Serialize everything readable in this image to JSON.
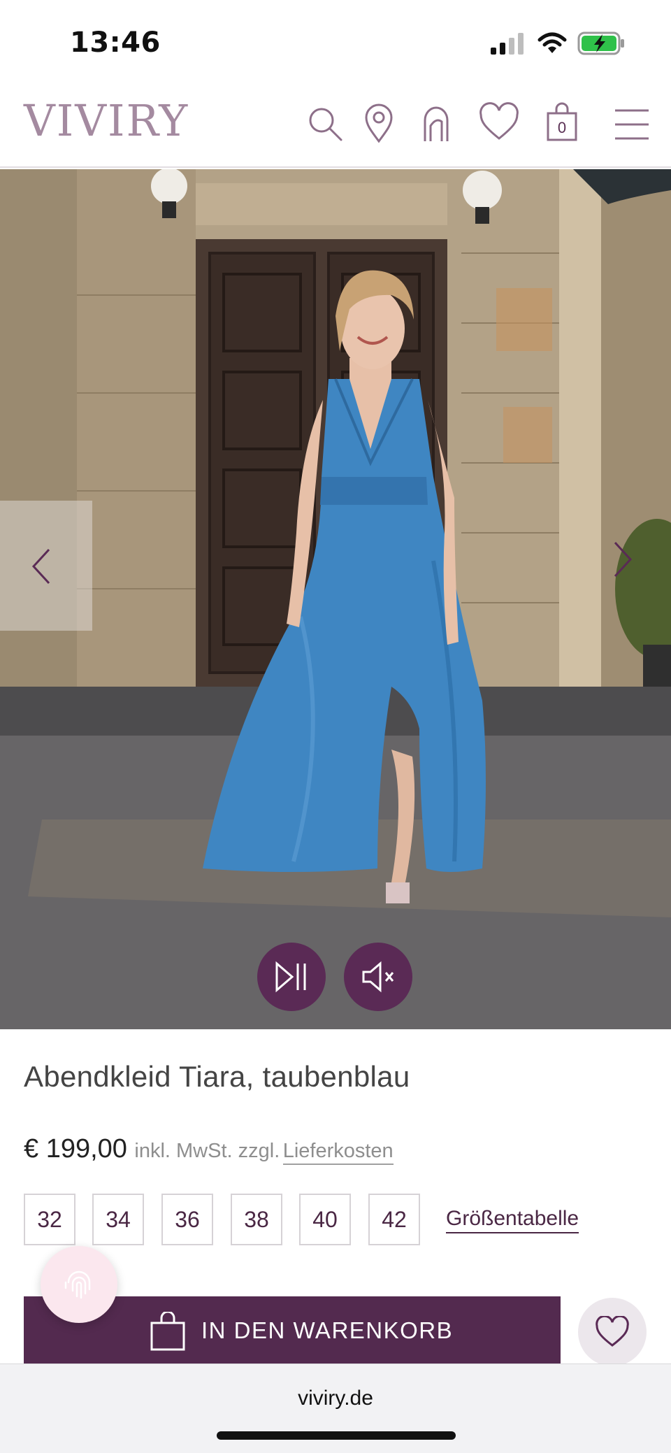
{
  "status_bar": {
    "time": "13:46",
    "icons": [
      "cellular-signal-icon",
      "wifi-icon",
      "battery-charging-icon"
    ]
  },
  "header": {
    "logo": "VIVIRY",
    "icons": [
      "search-icon",
      "location-pin-icon",
      "profile-face-icon",
      "heart-icon",
      "shopping-bag-icon",
      "menu-icon"
    ],
    "cart_count": "0"
  },
  "hero": {
    "media": "product video of model in blue evening gown",
    "controls": [
      "play-pause-icon",
      "mute-icon"
    ],
    "nav": [
      "chevron-left-icon",
      "chevron-right-icon"
    ]
  },
  "product": {
    "title": "Abendkleid Tiara, taubenblau",
    "price": "€ 199,00",
    "vat_note": "inkl. MwSt. zzgl.",
    "shipping_link": "Lieferkosten",
    "sizes": [
      "32",
      "34",
      "36",
      "38",
      "40",
      "42"
    ],
    "size_chart_link": "Größentabelle",
    "add_to_cart": "IN DEN WARENKORB"
  },
  "browser": {
    "url": "viviry.de"
  },
  "colors": {
    "brand_plum": "#532a4f",
    "logo_mauve": "#a48aa0",
    "dress_blue": "#3f86c2"
  }
}
